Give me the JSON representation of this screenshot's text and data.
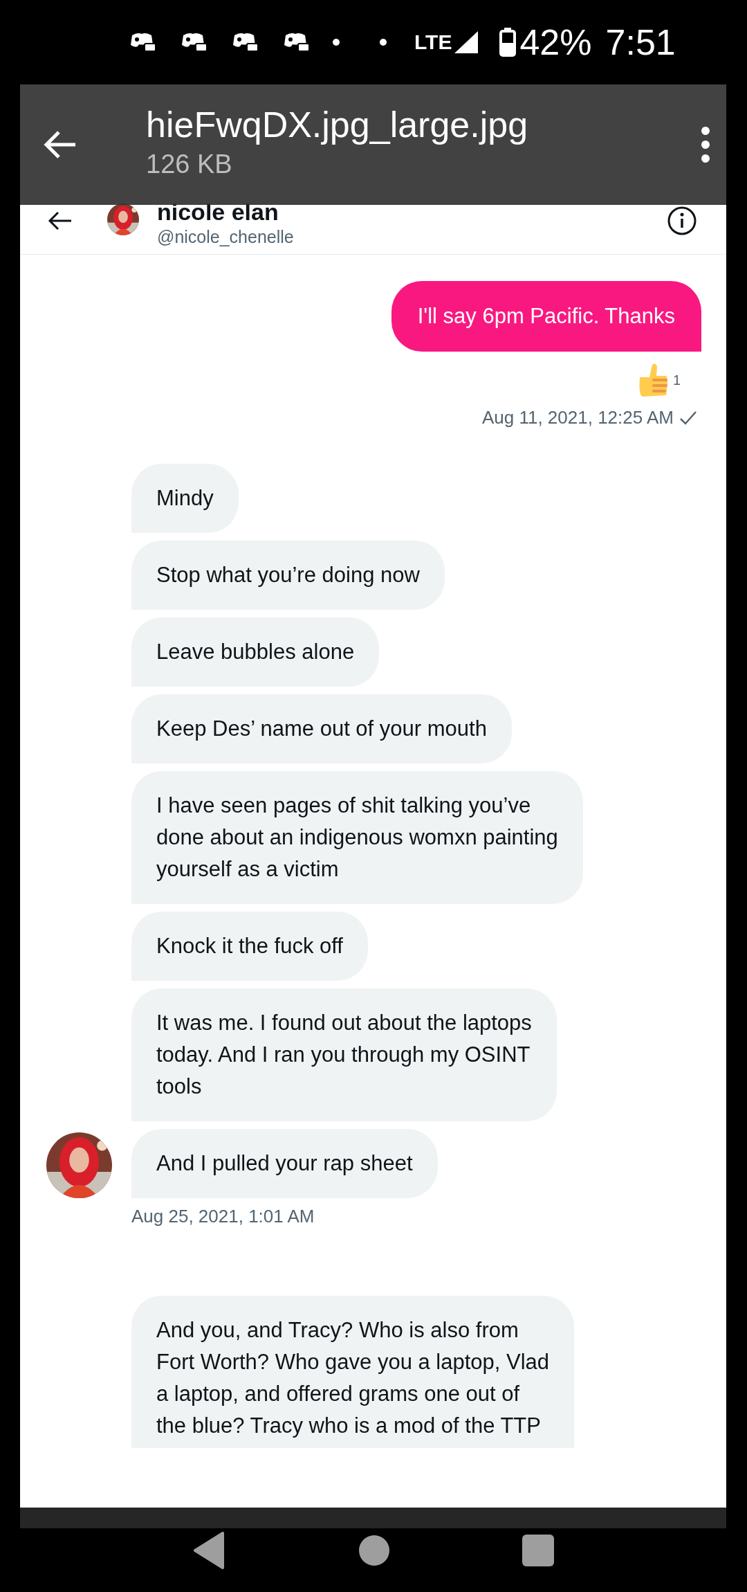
{
  "status_bar": {
    "network": "LTE",
    "battery": "42%",
    "time": "7:51"
  },
  "viewer": {
    "title": "hieFwqDX.jpg_large.jpg",
    "size": "126 KB"
  },
  "conversation": {
    "name": "nicole elan",
    "handle": "@nicole_chenelle",
    "items": [
      {
        "kind": "sent",
        "text": "I'll say 6pm Pacific. Thanks"
      },
      {
        "kind": "reaction",
        "count": "1"
      },
      {
        "kind": "timestamp_sent",
        "text": "Aug 11, 2021, 12:25 AM"
      },
      {
        "kind": "received",
        "text": "Mindy"
      },
      {
        "kind": "received",
        "text": "Stop what you’re doing now"
      },
      {
        "kind": "received",
        "text": "Leave bubbles alone"
      },
      {
        "kind": "received",
        "text": "Keep Des’ name out of your mouth"
      },
      {
        "kind": "received",
        "text": "I have seen pages of shit talking you’ve\ndone about an indigenous womxn painting\nyourself as a victim"
      },
      {
        "kind": "received",
        "text": "Knock it the fuck off"
      },
      {
        "kind": "received",
        "text": "It was me. I found out about the laptops\ntoday. And I ran you through my OSINT\ntools"
      },
      {
        "kind": "received",
        "avatar": true,
        "text": "And I pulled your rap sheet"
      },
      {
        "kind": "timestamp_received",
        "text": "Aug 25, 2021, 1:01 AM"
      },
      {
        "kind": "received",
        "cut": true,
        "text": "And you, and Tracy? Who is also from\nFort Worth? Who gave you a laptop, Vlad\na laptop, and offered grams one out of\nthe blue? Tracy who is a mod of the TTP"
      }
    ]
  }
}
